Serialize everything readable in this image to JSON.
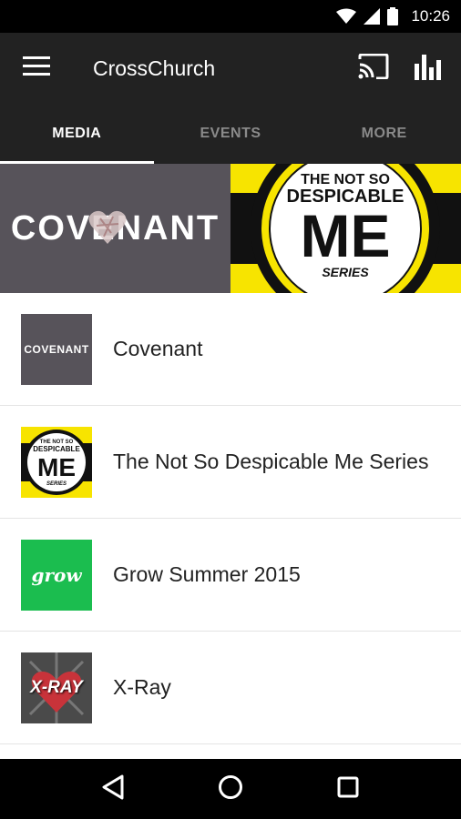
{
  "status_bar": {
    "time": "10:26",
    "icons": [
      "wifi-icon",
      "signal-icon",
      "battery-icon"
    ]
  },
  "app_bar": {
    "title": "CrossChurch",
    "icons": [
      "menu-icon",
      "cast-icon",
      "bar-chart-icon"
    ]
  },
  "tabs": [
    {
      "label": "MEDIA",
      "active": true
    },
    {
      "label": "EVENTS",
      "active": false
    },
    {
      "label": "MORE",
      "active": false
    }
  ],
  "banner": {
    "left_text": "COVENANT",
    "right_lines": [
      "THE NOT SO",
      "DESPICABLE",
      "ME",
      "SERIES"
    ]
  },
  "media_items": [
    {
      "title": "Covenant",
      "thumb_text": "COVENANT"
    },
    {
      "title": "The Not So Despicable Me Series",
      "thumb_lines": [
        "THE NOT SO",
        "DESPICABLE",
        "ME",
        "SERIES"
      ]
    },
    {
      "title": "Grow Summer 2015",
      "thumb_text": "grow"
    },
    {
      "title": "X-Ray",
      "thumb_text": "X-RAY"
    }
  ],
  "nav_bar": {
    "icons": [
      "back-icon",
      "home-icon",
      "recents-icon"
    ]
  },
  "colors": {
    "app_bar": "#222222",
    "covenant_bg": "#57535a",
    "despicable_yellow": "#f7e400",
    "grow_green": "#1bbd4f"
  }
}
